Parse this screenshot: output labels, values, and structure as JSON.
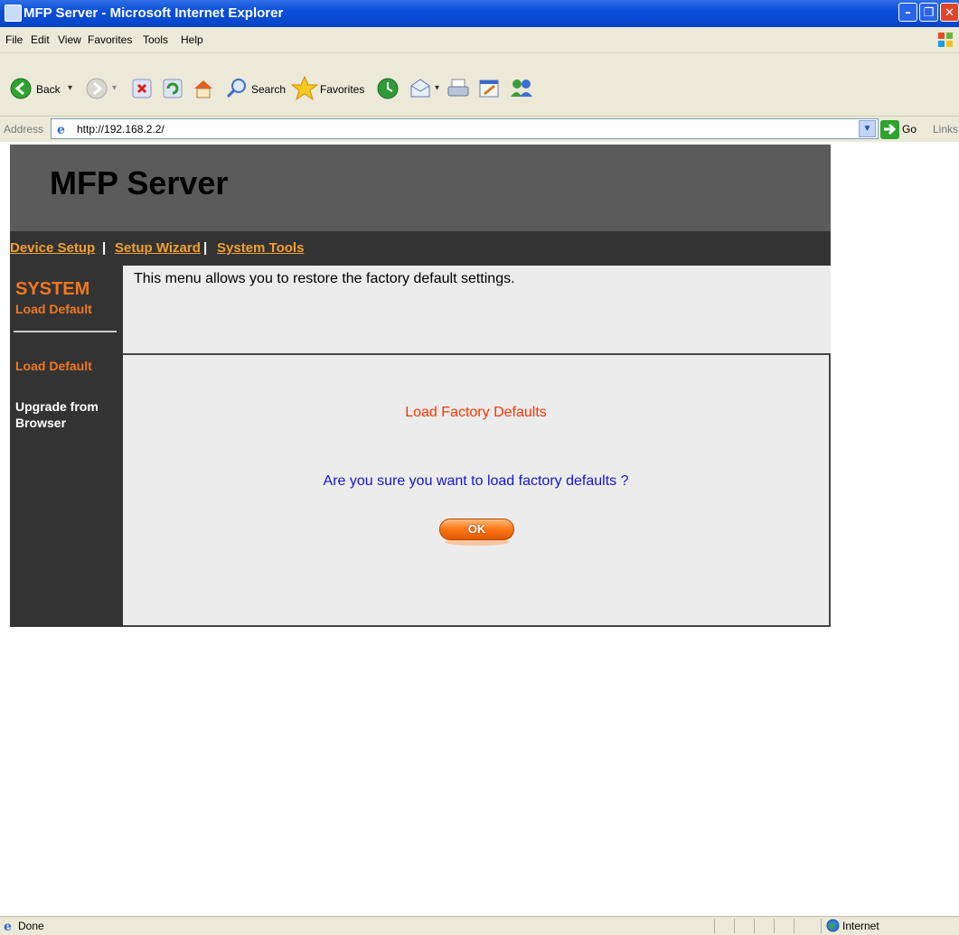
{
  "window": {
    "title": "MFP Server - Microsoft Internet Explorer"
  },
  "menu": {
    "items": [
      "File",
      "Edit",
      "View",
      "Favorites",
      "Tools",
      "Help"
    ]
  },
  "toolbar": {
    "back_label": "Back",
    "search_label": "Search",
    "favorites_label": "Favorites"
  },
  "address": {
    "label": "Address",
    "url": "http://192.168.2.2/",
    "go_label": "Go",
    "links_label": "Links"
  },
  "page": {
    "banner_title": "MFP Server",
    "nav": {
      "items": [
        "Device Setup",
        "Setup Wizard",
        "System Tools"
      ],
      "separator": "|"
    },
    "sidebar": {
      "section_title": "SYSTEM",
      "section_sub": "Load Default",
      "items": [
        "Load Default",
        "Upgrade from Browser"
      ]
    },
    "description": "This menu allows you to restore the factory default settings.",
    "heading": "Load Factory Defaults",
    "question": "Are you sure you want to load factory defaults ?",
    "ok_label": "OK"
  },
  "status": {
    "text": "Done",
    "zone": "Internet"
  },
  "colors": {
    "nav_link": "#f0a030",
    "sidebar_accent": "#f07820",
    "heading": "#ff3300",
    "question": "#1515d0",
    "ok_button": "#ff7a1a"
  }
}
